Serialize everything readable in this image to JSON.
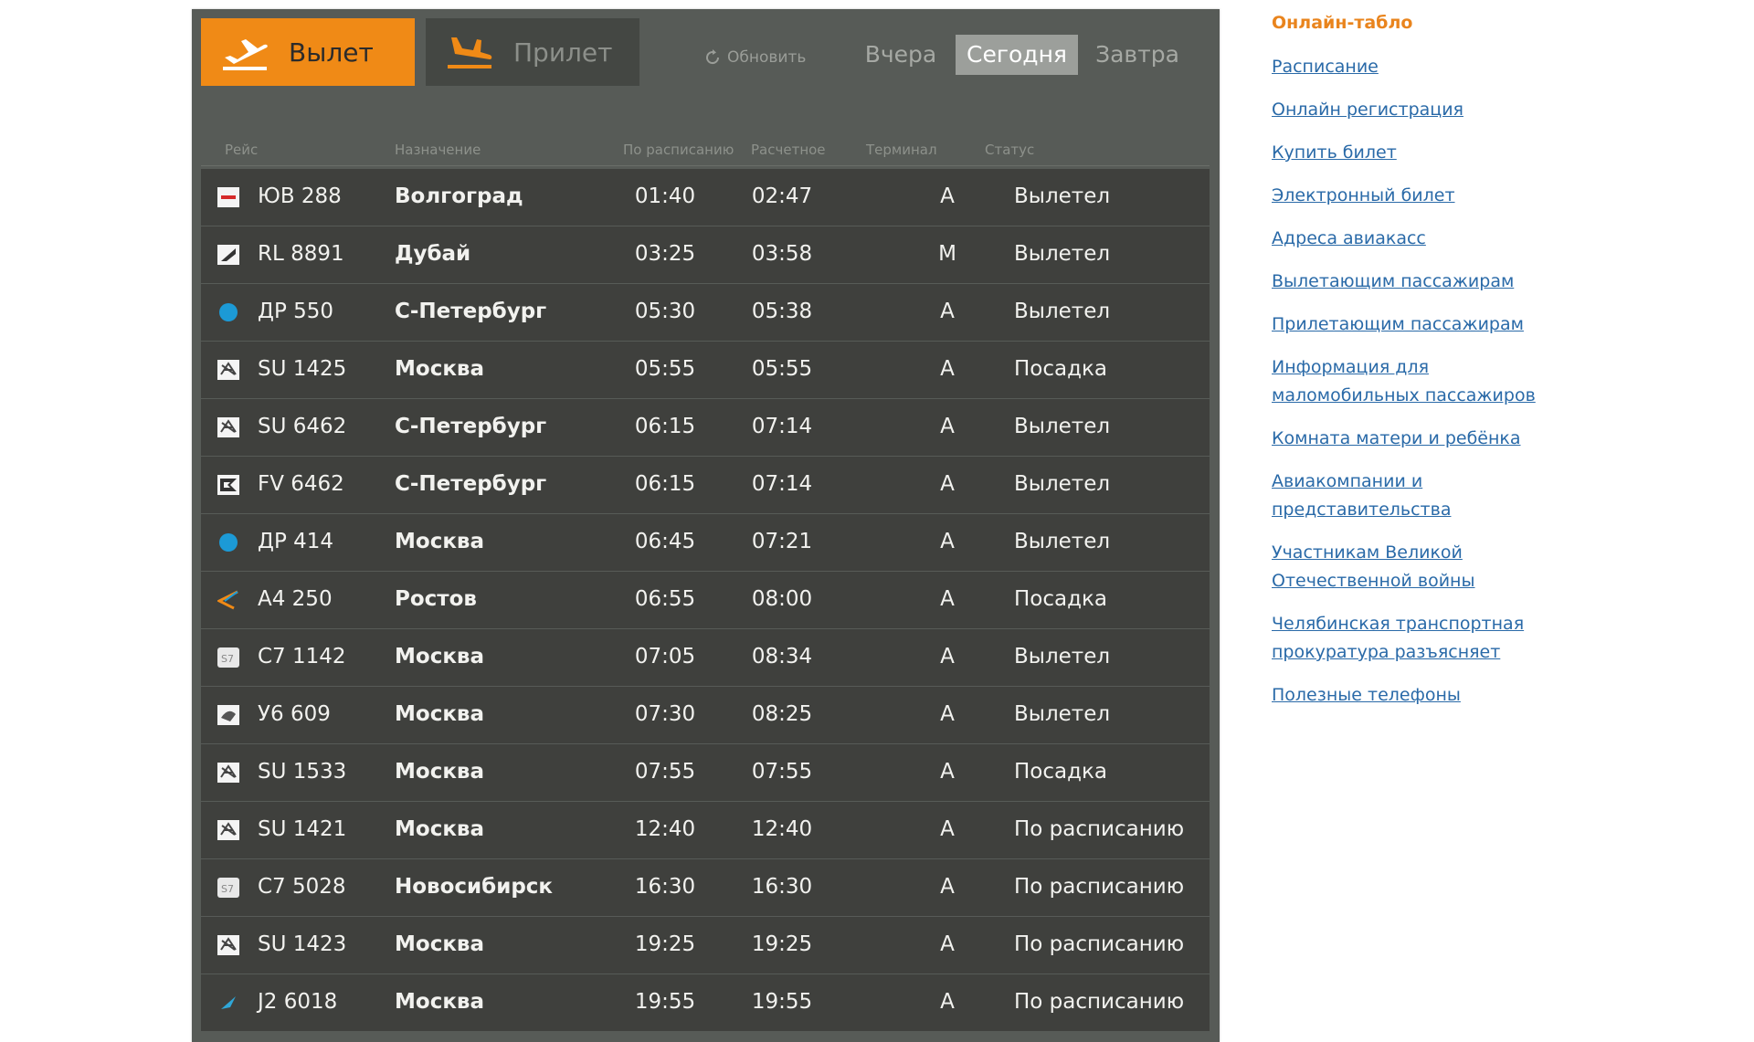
{
  "tabs": {
    "departure_label": "Вылет",
    "arrival_label": "Прилет",
    "refresh_label": "Обновить"
  },
  "days": {
    "yesterday": "Вчера",
    "today": "Сегодня",
    "tomorrow": "Завтра",
    "selected": "today"
  },
  "columns": {
    "flight": "Рейс",
    "destination": "Назначение",
    "scheduled": "По расписанию",
    "estimated": "Расчетное",
    "terminal": "Терминал",
    "status": "Статус"
  },
  "flights": [
    {
      "airline_icon": "redwings-logo-icon",
      "flight": "ЮВ 288",
      "destination": "Волгоград",
      "scheduled": "01:40",
      "estimated": "02:47",
      "terminal": "А",
      "status": "Вылетел"
    },
    {
      "airline_icon": "rossiya-logo-icon",
      "flight": "RL 8891",
      "destination": "Дубай",
      "scheduled": "03:25",
      "estimated": "03:58",
      "terminal": "М",
      "status": "Вылетел"
    },
    {
      "airline_icon": "blue-circle-logo-icon",
      "flight": "ДР 550",
      "destination": "С-Петербург",
      "scheduled": "05:30",
      "estimated": "05:38",
      "terminal": "А",
      "status": "Вылетел"
    },
    {
      "airline_icon": "aeroflot-logo-icon",
      "flight": "SU 1425",
      "destination": "Москва",
      "scheduled": "05:55",
      "estimated": "05:55",
      "terminal": "А",
      "status": "Посадка"
    },
    {
      "airline_icon": "aeroflot-logo-icon",
      "flight": "SU 6462",
      "destination": "С-Петербург",
      "scheduled": "06:15",
      "estimated": "07:14",
      "terminal": "А",
      "status": "Вылетел"
    },
    {
      "airline_icon": "rossiya-flag-logo-icon",
      "flight": "FV 6462",
      "destination": "С-Петербург",
      "scheduled": "06:15",
      "estimated": "07:14",
      "terminal": "А",
      "status": "Вылетел"
    },
    {
      "airline_icon": "blue-circle-logo-icon",
      "flight": "ДР 414",
      "destination": "Москва",
      "scheduled": "06:45",
      "estimated": "07:21",
      "terminal": "А",
      "status": "Вылетел"
    },
    {
      "airline_icon": "azimuth-logo-icon",
      "flight": "А4 250",
      "destination": "Ростов",
      "scheduled": "06:55",
      "estimated": "08:00",
      "terminal": "А",
      "status": "Посадка"
    },
    {
      "airline_icon": "s7-logo-icon",
      "flight": "С7 1142",
      "destination": "Москва",
      "scheduled": "07:05",
      "estimated": "08:34",
      "terminal": "А",
      "status": "Вылетел"
    },
    {
      "airline_icon": "ural-logo-icon",
      "flight": "У6 609",
      "destination": "Москва",
      "scheduled": "07:30",
      "estimated": "08:25",
      "terminal": "А",
      "status": "Вылетел"
    },
    {
      "airline_icon": "aeroflot-logo-icon",
      "flight": "SU 1533",
      "destination": "Москва",
      "scheduled": "07:55",
      "estimated": "07:55",
      "terminal": "А",
      "status": "Посадка"
    },
    {
      "airline_icon": "aeroflot-logo-icon",
      "flight": "SU 1421",
      "destination": "Москва",
      "scheduled": "12:40",
      "estimated": "12:40",
      "terminal": "А",
      "status": "По расписанию"
    },
    {
      "airline_icon": "s7-logo-icon",
      "flight": "С7 5028",
      "destination": "Новосибирск",
      "scheduled": "16:30",
      "estimated": "16:30",
      "terminal": "А",
      "status": "По расписанию"
    },
    {
      "airline_icon": "aeroflot-logo-icon",
      "flight": "SU 1423",
      "destination": "Москва",
      "scheduled": "19:25",
      "estimated": "19:25",
      "terminal": "А",
      "status": "По расписанию"
    },
    {
      "airline_icon": "azal-logo-icon",
      "flight": "J2 6018",
      "destination": "Москва",
      "scheduled": "19:55",
      "estimated": "19:55",
      "terminal": "А",
      "status": "По расписанию"
    }
  ],
  "sidebar": {
    "title": "Онлайн-табло",
    "links": [
      "Расписание",
      "Онлайн регистрация",
      "Купить билет",
      "Электронный билет",
      "Адреса авиакасс",
      "Вылетающим пассажирам",
      "Прилетающим пассажирам",
      "Информация для маломобильных пассажиров",
      "Комната матери и ребёнка",
      "Авиакомпании и представительства",
      "Участникам Великой Отечественной войны",
      "Челябинская транспортная прокуратура разъясняет",
      "Полезные телефоны"
    ]
  },
  "colors": {
    "board_bg": "#575b57",
    "row_bg": "#3f403d",
    "accent": "#f08a16",
    "link": "#2a6aa8"
  }
}
